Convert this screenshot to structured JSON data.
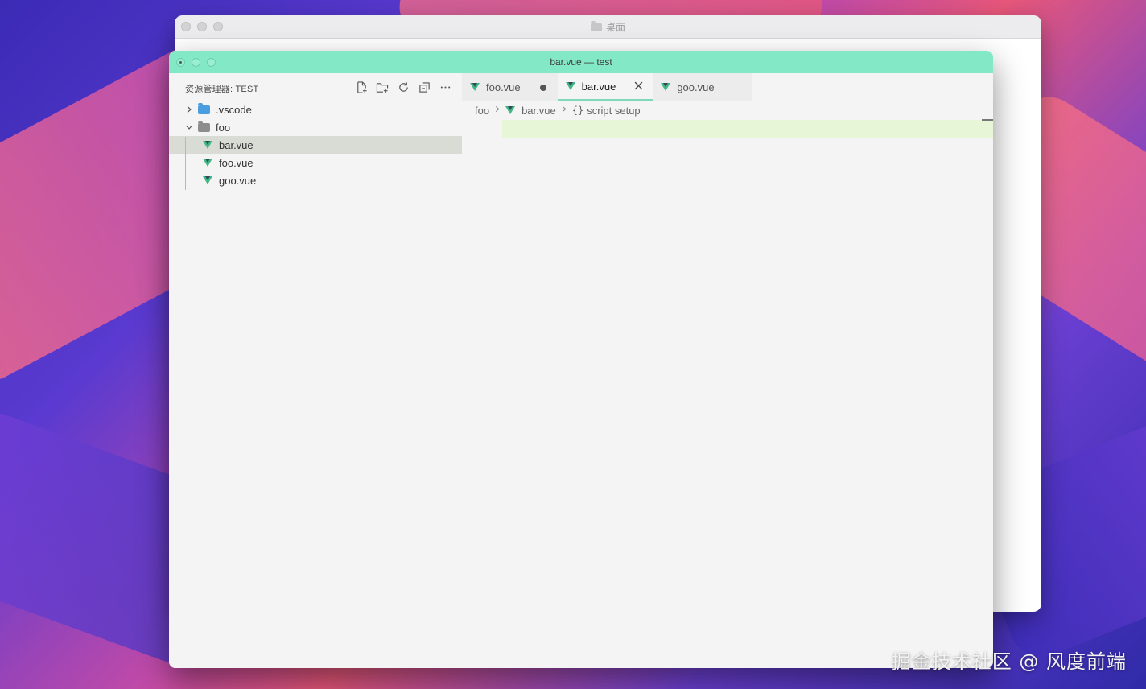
{
  "back_window": {
    "title": "桌面",
    "title_icon": "folder-icon"
  },
  "front_window": {
    "title": "bar.vue — test",
    "title_bar_color": "#83e8c6"
  },
  "sidebar": {
    "title": "资源管理器: TEST",
    "actions": [
      {
        "name": "new-file-icon"
      },
      {
        "name": "new-folder-icon"
      },
      {
        "name": "refresh-icon"
      },
      {
        "name": "collapse-all-icon"
      },
      {
        "name": "more-icon"
      }
    ],
    "tree": [
      {
        "label": ".vscode",
        "kind": "folder",
        "expanded": false
      },
      {
        "label": "foo",
        "kind": "folder",
        "expanded": true
      },
      {
        "label": "bar.vue",
        "kind": "vue-file",
        "selected": true
      },
      {
        "label": "foo.vue",
        "kind": "vue-file"
      },
      {
        "label": "goo.vue",
        "kind": "vue-file"
      }
    ]
  },
  "tabs": [
    {
      "label": "foo.vue",
      "state": "modified"
    },
    {
      "label": "bar.vue",
      "state": "active"
    },
    {
      "label": "goo.vue",
      "state": "inactive"
    }
  ],
  "breadcrumb": {
    "folder": "foo",
    "file": "bar.vue",
    "symbol": "script setup",
    "symbol_prefix": "{}"
  },
  "colors": {
    "vue_green": "#41b883",
    "line_highlight": "#e6f6d6",
    "selected_row": "#d9dcd4"
  },
  "watermark": "掘金技术社区 @ 风度前端"
}
